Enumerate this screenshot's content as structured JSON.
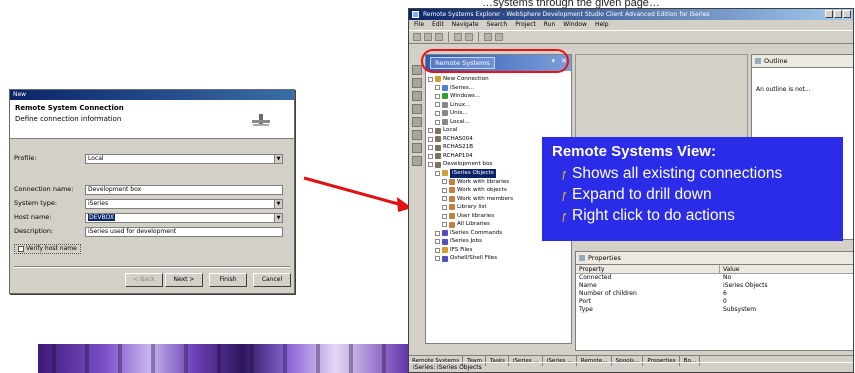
{
  "slide": {
    "top_text": "…systems through the given page…"
  },
  "dialog": {
    "title": "New",
    "heading": "Remote System Connection",
    "subheading": "Define connection information",
    "fields": [
      {
        "label": "Profile:",
        "value": "Local"
      },
      {
        "label": "Connection name:",
        "value": "Development box"
      },
      {
        "label": "System type:",
        "value": "iSeries"
      },
      {
        "label": "Host name:",
        "value": "DEVBOX"
      },
      {
        "label": "Description:",
        "value": "iSeries used for development"
      }
    ],
    "checkbox_label": "Verify host name",
    "buttons": {
      "back": "< Back",
      "next": "Next >",
      "finish": "Finish",
      "cancel": "Cancel"
    }
  },
  "workbench": {
    "title": "Remote Systems Explorer - WebSphere Development Studio Client Advanced Edition for iSeries",
    "menu": [
      "File",
      "Edit",
      "Navigate",
      "Search",
      "Project",
      "Run",
      "Window",
      "Help"
    ],
    "view_tab": "Remote Systems",
    "tree": [
      {
        "label": "New Connection",
        "level": 0,
        "color": "#d0a030"
      },
      {
        "label": "iSeries...",
        "level": 1,
        "color": "#4f7fd0"
      },
      {
        "label": "Windows...",
        "level": 1,
        "color": "#30a030"
      },
      {
        "label": "Linux...",
        "level": 1,
        "color": "#888888"
      },
      {
        "label": "Unix...",
        "level": 1,
        "color": "#888888"
      },
      {
        "label": "Local...",
        "level": 1,
        "color": "#888888"
      },
      {
        "label": "Local",
        "level": 0,
        "color": "#807060"
      },
      {
        "label": "RCHAS004",
        "level": 0,
        "color": "#807060"
      },
      {
        "label": "RCHAS21B",
        "level": 0,
        "color": "#807060"
      },
      {
        "label": "RCHAP104",
        "level": 0,
        "color": "#807060"
      },
      {
        "label": "Development box",
        "level": 0,
        "color": "#807060"
      },
      {
        "label": "iSeries Objects",
        "level": 1,
        "color": "#d0a030",
        "selected": true
      },
      {
        "label": "Work with libraries",
        "level": 2,
        "color": "#c08040"
      },
      {
        "label": "Work with objects",
        "level": 2,
        "color": "#c08040"
      },
      {
        "label": "Work with members",
        "level": 2,
        "color": "#c08040"
      },
      {
        "label": "Library list",
        "level": 2,
        "color": "#c08040"
      },
      {
        "label": "User libraries",
        "level": 2,
        "color": "#c08040"
      },
      {
        "label": "All Libraries",
        "level": 2,
        "color": "#c08040"
      },
      {
        "label": "iSeries Commands",
        "level": 1,
        "color": "#5050c0"
      },
      {
        "label": "iSeries Jobs",
        "level": 1,
        "color": "#5050c0"
      },
      {
        "label": "IFS Files",
        "level": 1,
        "color": "#d0a030"
      },
      {
        "label": "Qshell/Shell Files",
        "level": 1,
        "color": "#5050c0"
      }
    ],
    "outline": {
      "tab": "Outline",
      "message": "An outline is not..."
    },
    "properties": {
      "tab": "Properties",
      "columns": [
        "Property",
        "Value"
      ],
      "rows": [
        [
          "Connected",
          "No"
        ],
        [
          "Name",
          "iSeries Objects"
        ],
        [
          "Number of children",
          "6"
        ],
        [
          "Port",
          "0"
        ],
        [
          "Type",
          "Subsystem"
        ]
      ]
    },
    "bottom_tabs": [
      "Remote Systems",
      "Team",
      "Tasks",
      "iSeries ...",
      "iSeries ...",
      "Remote...",
      "Spools...",
      "Properties",
      "Bo..."
    ],
    "status": "iSeries: iSeries Objects"
  },
  "callout": {
    "title": "Remote Systems View:",
    "items": [
      "Shows all existing connections",
      "Expand to drill down",
      "Right click to do actions"
    ]
  },
  "colors": {
    "callout_bg": "#2a2ce8",
    "arrow": "#e11111",
    "highlight": "#e11111"
  }
}
